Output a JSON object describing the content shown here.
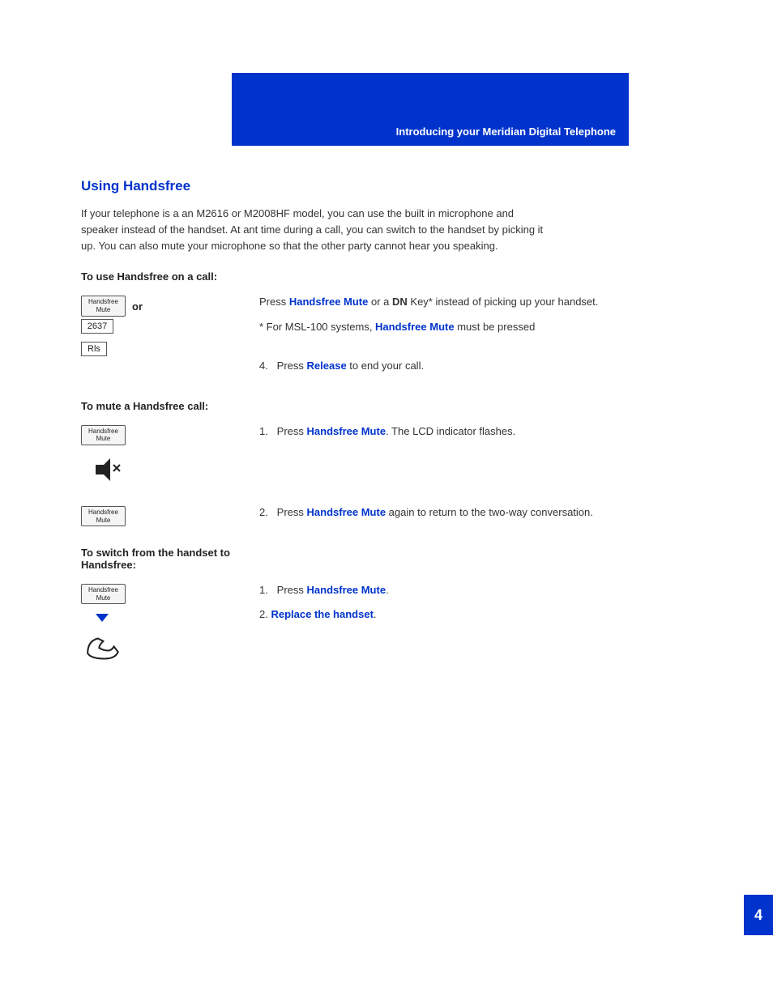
{
  "header": {
    "banner_title": "Introducing your Meridian Digital Telephone",
    "page_number": "4"
  },
  "section": {
    "title": "Using Handsfree",
    "intro": "If your telephone is a an M2616 or M2008HF model, you can use the built in microphone and speaker instead of the handset. At ant time during a call, you can switch to the handset by picking it up. You can also mute your microphone so that the other party cannot hear you speaking.",
    "sub1_heading": "To use Handsfree on a call:",
    "sub1_right_text1": "Press ",
    "sub1_handsfree_mute_1": "Handsfree Mute",
    "sub1_or": " or a ",
    "sub1_dn": "DN",
    "sub1_key_text": " Key* instead of picking up your handset.",
    "sub1_note": "* For MSL-100 systems, ",
    "sub1_note_blue": "Handsfree Mute",
    "sub1_note_end": " must be pressed",
    "sub1_item4_pre": "4.    Press ",
    "sub1_release": "Release",
    "sub1_item4_end": " to end your call.",
    "key_handsfree_mute": "Handsfree\nMute",
    "key_2637": "2637",
    "key_rls": "Rls",
    "sub2_heading": "To mute a Handsfree call:",
    "sub2_item1_pre": "1.    Press ",
    "sub2_handsfree_mute": "Handsfree Mute",
    "sub2_item1_end": ". The LCD indicator flashes.",
    "sub2_item2_pre": "2.    Press ",
    "sub2_handsfree_mute2": "Handsfree Mute",
    "sub2_item2_end": " again to return to the two-way conversation.",
    "sub3_heading": "To switch from the handset to Handsfree:",
    "sub3_item1_pre": "1.    Press ",
    "sub3_handsfree_mute": "Handsfree Mute",
    "sub3_item1_end": ".",
    "sub3_item2_pre": "2. ",
    "sub3_replace": "Replace the handset",
    "sub3_item2_end": "."
  }
}
